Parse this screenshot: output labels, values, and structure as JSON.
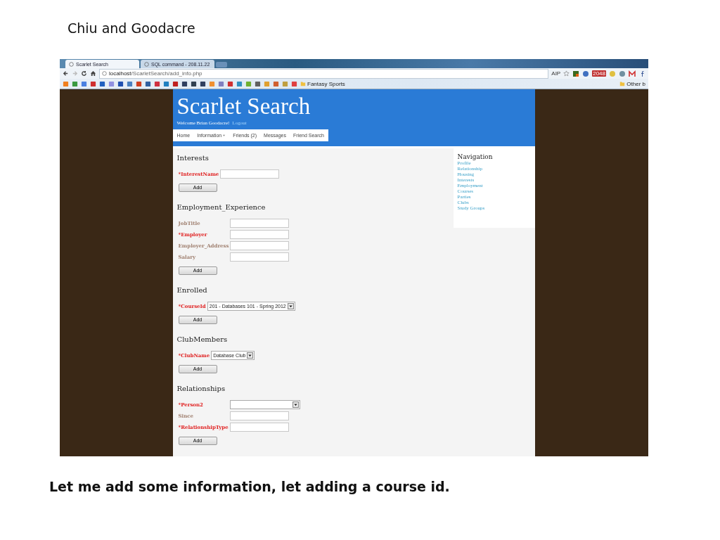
{
  "slide_title": "Chiu and Goodacre",
  "browser": {
    "tabs": [
      {
        "label": "Scarlet Search",
        "selected": true
      },
      {
        "label": "SQL command - 208.11.22",
        "selected": false
      }
    ],
    "address": {
      "host": "localhost",
      "path": "/ScarletSearch/add_info.php"
    },
    "extension_texts": [
      "AIP",
      "2048"
    ],
    "bookmarks": [
      "Fantasy Sports"
    ],
    "other_bookmarks": "Other b"
  },
  "site": {
    "title": "Scarlet Search",
    "welcome": "Welcome Brian Goodacre!",
    "logout": "Logout",
    "menu": [
      {
        "label": "Home",
        "dropdown": false
      },
      {
        "label": "Information",
        "dropdown": true
      },
      {
        "label": "Friends (2)",
        "dropdown": false
      },
      {
        "label": "Messages",
        "dropdown": false
      },
      {
        "label": "Friend Search",
        "dropdown": false
      }
    ]
  },
  "sections": [
    {
      "heading": "Interests",
      "button": "Add",
      "fields": [
        {
          "label": "*InterestName",
          "required": true,
          "kind": "text"
        }
      ]
    },
    {
      "heading": "Employment_Experience",
      "button": "Add",
      "fields": [
        {
          "label": "JobTitle",
          "required": false,
          "kind": "text"
        },
        {
          "label": "*Employer",
          "required": true,
          "kind": "text"
        },
        {
          "label": "Employer_Address",
          "required": false,
          "kind": "text"
        },
        {
          "label": "Salary",
          "required": false,
          "kind": "text"
        }
      ]
    },
    {
      "heading": "Enrolled",
      "button": "Add",
      "fields": [
        {
          "label": "*CourseId",
          "required": true,
          "kind": "select",
          "value": "201 - Databases 101 - Spring 2012"
        }
      ]
    },
    {
      "heading": "ClubMembers",
      "button": "Add",
      "fields": [
        {
          "label": "*ClubName",
          "required": true,
          "kind": "select",
          "value": "Database Club"
        }
      ]
    },
    {
      "heading": "Relationships",
      "button": "Add",
      "fields": [
        {
          "label": "*Person2",
          "required": true,
          "kind": "select",
          "wide": true
        },
        {
          "label": "Since",
          "required": false,
          "kind": "text"
        },
        {
          "label": "*RelationshipType",
          "required": true,
          "kind": "text"
        }
      ]
    }
  ],
  "navigation": {
    "heading": "Navigation",
    "links": [
      "Profile",
      "Relationship",
      "Housing",
      "Interests",
      "Employment",
      "Courses",
      "Parties",
      "Clubs",
      "Study Groups"
    ]
  },
  "caption": "Let me add some information, let adding a course id."
}
